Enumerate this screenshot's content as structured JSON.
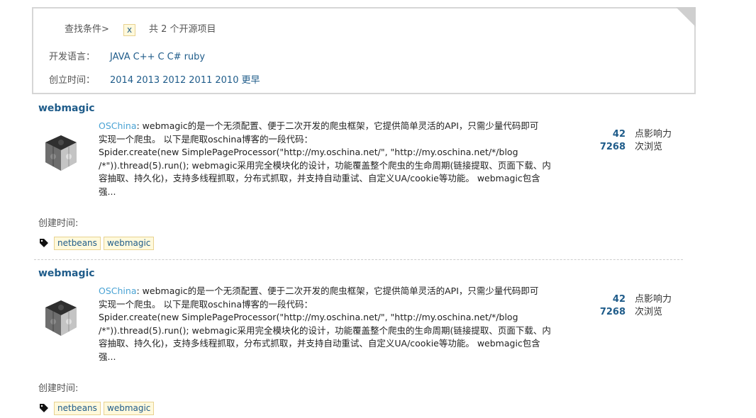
{
  "filter": {
    "search_label": "查找条件>",
    "clear_tag": "x",
    "count_text": "共 2 个开源项目",
    "language_label": "开发语言：",
    "languages": [
      "JAVA",
      "C++",
      "C",
      "C#",
      "ruby"
    ],
    "created_label": "创立时间：",
    "years": [
      "2014",
      "2013",
      "2012",
      "2011",
      "2010",
      "更早"
    ]
  },
  "projects": [
    {
      "title": "webmagic",
      "thumb_icon": "puzzle-cube-icon",
      "source": "OSChina",
      "desc_line1": ": webmagic的是一个无须配置、便于二次开发的爬虫框架，它提供简单灵活的API，只需少量代码即可",
      "desc_line2": "实现一个爬虫。 以下是爬取oschina博客的一段代码：",
      "desc_line3": "Spider.create(new SimplePageProcessor(\"http://my.oschina.net/\", \"http://my.oschina.net/*/blog",
      "desc_line4": "/*\")).thread(5).run(); webmagic采用完全模块化的设计，功能覆盖整个爬虫的生命周期(链接提取、页面下载、内",
      "desc_line5": "容抽取、持久化)，支持多线程抓取，分布式抓取，并支持自动重试、自定义UA/cookie等功能。 webmagic包含",
      "desc_line6": "强...",
      "influence": "42",
      "influence_label": "点影响力",
      "views": "7268",
      "views_label": "次浏览",
      "created_label": "创建时间:",
      "tag_icon": "tag-icon",
      "tags": [
        "netbeans",
        "webmagic"
      ]
    },
    {
      "title": "webmagic",
      "thumb_icon": "puzzle-cube-icon",
      "source": "OSChina",
      "desc_line1": ": webmagic的是一个无须配置、便于二次开发的爬虫框架，它提供简单灵活的API，只需少量代码即可",
      "desc_line2": "实现一个爬虫。 以下是爬取oschina博客的一段代码：",
      "desc_line3": "Spider.create(new SimplePageProcessor(\"http://my.oschina.net/\", \"http://my.oschina.net/*/blog",
      "desc_line4": "/*\")).thread(5).run(); webmagic采用完全模块化的设计，功能覆盖整个爬虫的生命周期(链接提取、页面下载、内",
      "desc_line5": "容抽取、持久化)，支持多线程抓取，分布式抓取，并支持自动重试、自定义UA/cookie等功能。 webmagic包含",
      "desc_line6": "强...",
      "influence": "42",
      "influence_label": "点影响力",
      "views": "7268",
      "views_label": "次浏览",
      "created_label": "创建时间:",
      "tag_icon": "tag-icon",
      "tags": [
        "netbeans",
        "webmagic"
      ]
    }
  ]
}
